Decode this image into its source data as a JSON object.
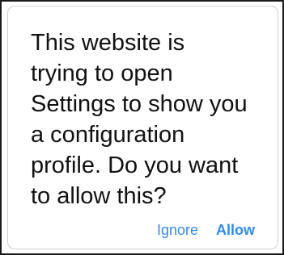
{
  "alert": {
    "message_lines": [
      "This website is",
      "trying to open",
      "Settings to show you",
      "a configuration",
      "profile. Do you want",
      "to allow this?"
    ],
    "buttons": {
      "ignore_label": "Ignore",
      "allow_label": "Allow"
    }
  },
  "colors": {
    "button_text": "#2f8cf4",
    "message_text": "#111111"
  }
}
